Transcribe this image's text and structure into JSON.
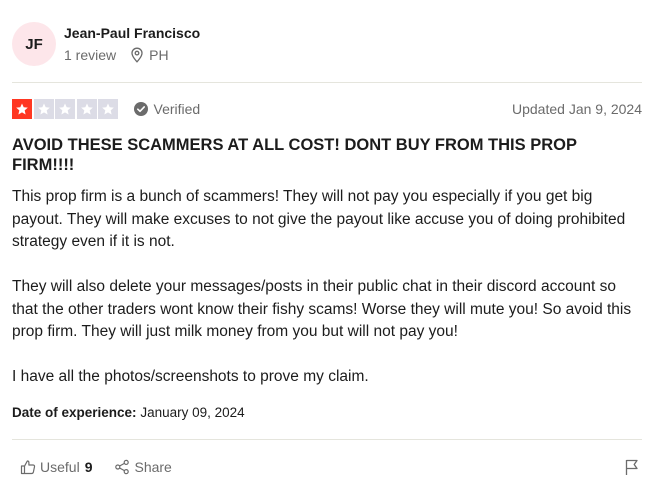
{
  "reviewer": {
    "initials": "JF",
    "name": "Jean-Paul Francisco",
    "review_count": "1 review",
    "location": "PH",
    "avatar_color": "#fde6ea"
  },
  "review": {
    "rating": 1,
    "max_rating": 5,
    "star_color_filled": "#ff3722",
    "star_color_empty": "#dcdce6",
    "verified_label": "Verified",
    "updated_label": "Updated Jan 9, 2024",
    "title": "AVOID THESE SCAMMERS AT ALL COST! DONT BUY FROM THIS PROP FIRM!!!!",
    "paragraphs": [
      "This prop firm is a bunch of scammers! They will not pay you especially if you get big payout. They will make excuses to not give the payout like accuse you of doing prohibited strategy even if it is not.",
      "They will also delete your messages/posts in their public chat in their discord account so that the other traders wont know their fishy scams! Worse they will mute you! So avoid this prop firm. They will just milk money from you but will not pay you!",
      "I have all the photos/screenshots to prove my claim."
    ],
    "experience_label": "Date of experience:",
    "experience_date": "January 09, 2024"
  },
  "actions": {
    "useful_label": "Useful",
    "useful_count": "9",
    "share_label": "Share",
    "icons": [
      "thumbs-up-icon",
      "share-icon",
      "flag-icon"
    ]
  }
}
